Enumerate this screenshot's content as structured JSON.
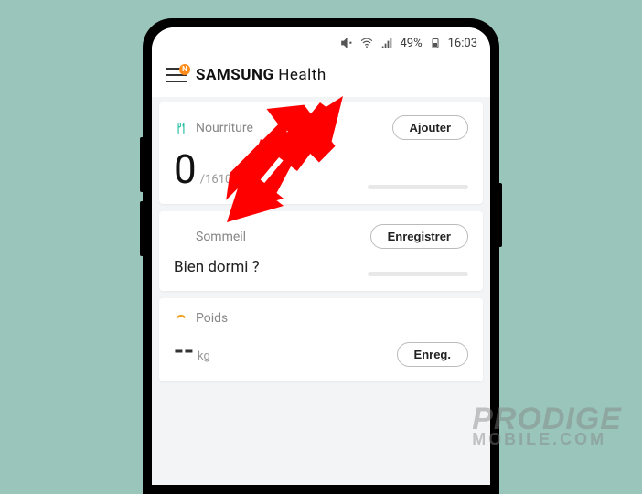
{
  "statusbar": {
    "battery_pct": "49%",
    "time": "16:03"
  },
  "header": {
    "menu_badge": "N",
    "title_brand": "SAMSUNG",
    "title_app": "Health"
  },
  "cards": {
    "food": {
      "label": "Nourriture",
      "button": "Ajouter",
      "value": "0",
      "goal": "/1610 kcal"
    },
    "sleep": {
      "label": "Sommeil",
      "button": "Enregistrer",
      "question": "Bien dormi ?"
    },
    "weight": {
      "label": "Poids",
      "button": "Enreg.",
      "value": "--",
      "unit": "kg"
    }
  },
  "watermark": {
    "line1": "PRODIGE",
    "line2": "MOBILE.COM"
  },
  "icons": {
    "mute": "mute-icon",
    "wifi": "wifi-icon",
    "signal": "signal-icon",
    "battery": "battery-icon",
    "fork": "fork-knife-icon",
    "moon": "moon-icon",
    "scale": "scale-icon"
  }
}
